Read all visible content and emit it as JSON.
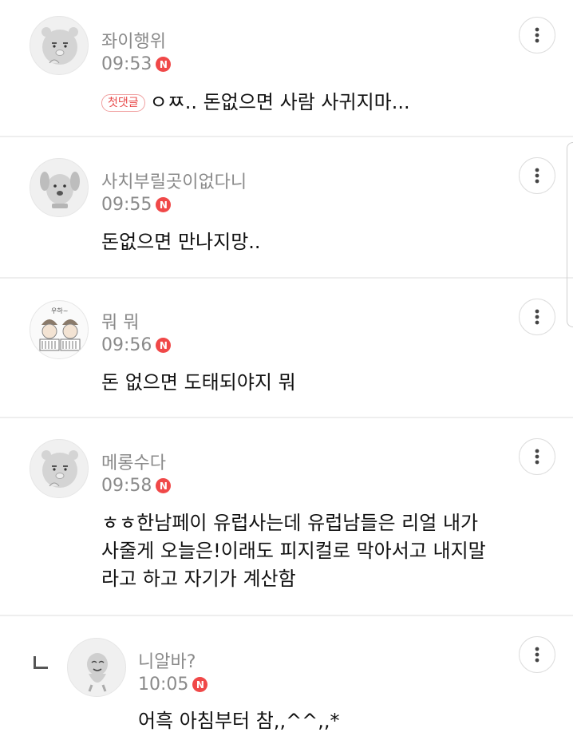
{
  "comments": [
    {
      "author": "좌이행위",
      "time": "09:53",
      "new_badge": "N",
      "first_badge": "첫댓글",
      "text": "ㅇㅉ.. 돈없으면 사람 사귀지마...",
      "avatar_icon": "ryan-character-icon"
    },
    {
      "author": "사치부릴곳이없다니",
      "time": "09:55",
      "new_badge": "N",
      "text": "돈없으면 만나지망..",
      "avatar_icon": "frodo-dog-icon"
    },
    {
      "author": "뭐 뭐",
      "time": "09:56",
      "new_badge": "N",
      "text": "돈 없으면 도태되야지 뭐",
      "avatar_icon": "drawn-couple-icon",
      "avatar_caption": "우하~"
    },
    {
      "author": "메롱수다",
      "time": "09:58",
      "new_badge": "N",
      "text_lines": [
        "ㅎㅎ한남페이 유럽사는데 유럽남들은 리얼 내가",
        "사줄게 오늘은!이래도 피지컬로 막아서고 내지말",
        "라고 하고 자기가 계산함"
      ],
      "avatar_icon": "ryan-character-icon"
    },
    {
      "author": "니알바?",
      "time": "10:05",
      "new_badge": "N",
      "text": "어흑 아침부터 참,,^^,,*",
      "avatar_icon": "muzi-character-icon",
      "is_reply": true
    }
  ],
  "more_icon": "more-vertical-icon",
  "reply_icon": "reply-arrow-icon",
  "colors": {
    "meta_gray": "#8a8a8a",
    "badge_red": "#f04848",
    "divider": "#eeeeee",
    "text": "#111111"
  }
}
